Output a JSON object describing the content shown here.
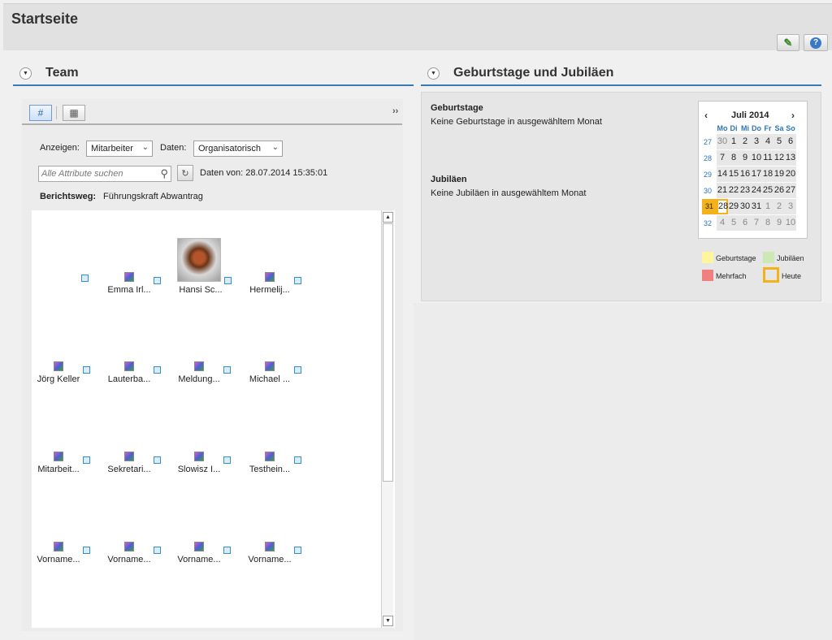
{
  "header": {
    "title": "Startseite",
    "buttons": [
      {
        "icon": "person-edit-icon"
      },
      {
        "icon": "help-icon"
      }
    ]
  },
  "team": {
    "title": "Team",
    "more": "››",
    "filters": {
      "show_label": "Anzeigen:",
      "show_value": "Mitarbeiter",
      "data_label": "Daten:",
      "data_value": "Organisatorisch"
    },
    "search": {
      "placeholder": "Alle Attribute suchen"
    },
    "data_from": "Daten von: 28.07.2014 15:35:01",
    "report_line": {
      "label": "Berichtsweg:",
      "value": "Führungskraft Abwantrag"
    },
    "members_row1": [
      "Emma Irl...",
      "Hansi Sc...",
      "Hermelij..."
    ],
    "members_row2": [
      "Jörg Keller",
      "Lauterba...",
      "Meldung...",
      "Michael ..."
    ],
    "members_row3": [
      "Mitarbeit...",
      "Sekretari...",
      "Slowisz I...",
      "Testhein..."
    ],
    "members_row4": [
      "Vorname...",
      "Vorname...",
      "Vorname...",
      "Vorname..."
    ]
  },
  "birthdays": {
    "title": "Geburtstage und Jubiläen",
    "birthdays_title": "Geburtstage",
    "birthdays_text": "Keine Geburtstage in ausgewähltem Monat",
    "jubilee_title": "Jubiläen",
    "jubilee_text": "Keine Jubiläen in ausgewähltem Monat",
    "calendar": {
      "month": "Juli 2014",
      "prev": "‹",
      "next": "›",
      "weekdays": [
        "Mo",
        "Di",
        "Mi",
        "Do",
        "Fr",
        "Sa",
        "So"
      ],
      "weeks": [
        "27",
        "28",
        "29",
        "30",
        "31",
        "32"
      ],
      "rows": [
        [
          "30",
          "1",
          "2",
          "3",
          "4",
          "5",
          "6"
        ],
        [
          "7",
          "8",
          "9",
          "10",
          "11",
          "12",
          "13"
        ],
        [
          "14",
          "15",
          "16",
          "17",
          "18",
          "19",
          "20"
        ],
        [
          "21",
          "22",
          "23",
          "24",
          "25",
          "26",
          "27"
        ],
        [
          "28",
          "29",
          "30",
          "31",
          "1",
          "2",
          "3"
        ],
        [
          "4",
          "5",
          "6",
          "7",
          "8",
          "9",
          "10"
        ]
      ],
      "today": "28"
    },
    "legend": {
      "birthdays": "Geburtstage",
      "jubilees": "Jubiläen",
      "multiple": "Mehrfach",
      "today": "Heute"
    },
    "colors": {
      "birthdays": "#fff59d",
      "jubilees": "#cde8b4",
      "multiple": "#f08080",
      "today": "#f3b21a"
    }
  }
}
